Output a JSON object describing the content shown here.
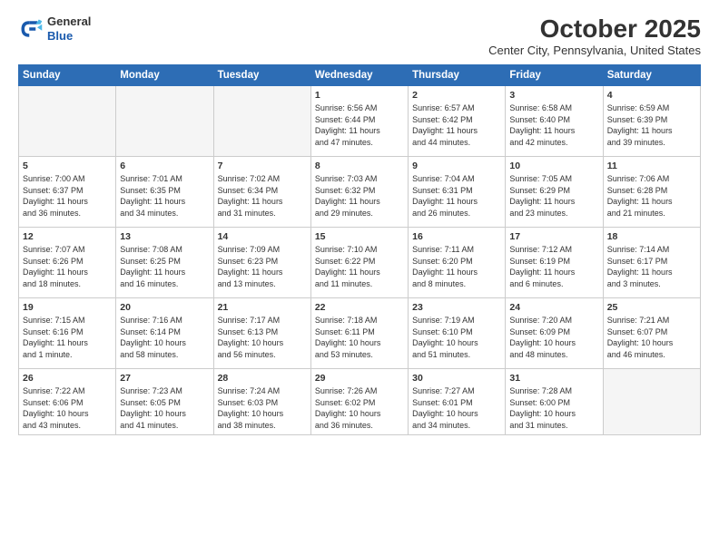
{
  "logo": {
    "general": "General",
    "blue": "Blue"
  },
  "header": {
    "month_title": "October 2025",
    "location": "Center City, Pennsylvania, United States"
  },
  "weekdays": [
    "Sunday",
    "Monday",
    "Tuesday",
    "Wednesday",
    "Thursday",
    "Friday",
    "Saturday"
  ],
  "weeks": [
    [
      {
        "day": "",
        "info": ""
      },
      {
        "day": "",
        "info": ""
      },
      {
        "day": "",
        "info": ""
      },
      {
        "day": "1",
        "info": "Sunrise: 6:56 AM\nSunset: 6:44 PM\nDaylight: 11 hours\nand 47 minutes."
      },
      {
        "day": "2",
        "info": "Sunrise: 6:57 AM\nSunset: 6:42 PM\nDaylight: 11 hours\nand 44 minutes."
      },
      {
        "day": "3",
        "info": "Sunrise: 6:58 AM\nSunset: 6:40 PM\nDaylight: 11 hours\nand 42 minutes."
      },
      {
        "day": "4",
        "info": "Sunrise: 6:59 AM\nSunset: 6:39 PM\nDaylight: 11 hours\nand 39 minutes."
      }
    ],
    [
      {
        "day": "5",
        "info": "Sunrise: 7:00 AM\nSunset: 6:37 PM\nDaylight: 11 hours\nand 36 minutes."
      },
      {
        "day": "6",
        "info": "Sunrise: 7:01 AM\nSunset: 6:35 PM\nDaylight: 11 hours\nand 34 minutes."
      },
      {
        "day": "7",
        "info": "Sunrise: 7:02 AM\nSunset: 6:34 PM\nDaylight: 11 hours\nand 31 minutes."
      },
      {
        "day": "8",
        "info": "Sunrise: 7:03 AM\nSunset: 6:32 PM\nDaylight: 11 hours\nand 29 minutes."
      },
      {
        "day": "9",
        "info": "Sunrise: 7:04 AM\nSunset: 6:31 PM\nDaylight: 11 hours\nand 26 minutes."
      },
      {
        "day": "10",
        "info": "Sunrise: 7:05 AM\nSunset: 6:29 PM\nDaylight: 11 hours\nand 23 minutes."
      },
      {
        "day": "11",
        "info": "Sunrise: 7:06 AM\nSunset: 6:28 PM\nDaylight: 11 hours\nand 21 minutes."
      }
    ],
    [
      {
        "day": "12",
        "info": "Sunrise: 7:07 AM\nSunset: 6:26 PM\nDaylight: 11 hours\nand 18 minutes."
      },
      {
        "day": "13",
        "info": "Sunrise: 7:08 AM\nSunset: 6:25 PM\nDaylight: 11 hours\nand 16 minutes."
      },
      {
        "day": "14",
        "info": "Sunrise: 7:09 AM\nSunset: 6:23 PM\nDaylight: 11 hours\nand 13 minutes."
      },
      {
        "day": "15",
        "info": "Sunrise: 7:10 AM\nSunset: 6:22 PM\nDaylight: 11 hours\nand 11 minutes."
      },
      {
        "day": "16",
        "info": "Sunrise: 7:11 AM\nSunset: 6:20 PM\nDaylight: 11 hours\nand 8 minutes."
      },
      {
        "day": "17",
        "info": "Sunrise: 7:12 AM\nSunset: 6:19 PM\nDaylight: 11 hours\nand 6 minutes."
      },
      {
        "day": "18",
        "info": "Sunrise: 7:14 AM\nSunset: 6:17 PM\nDaylight: 11 hours\nand 3 minutes."
      }
    ],
    [
      {
        "day": "19",
        "info": "Sunrise: 7:15 AM\nSunset: 6:16 PM\nDaylight: 11 hours\nand 1 minute."
      },
      {
        "day": "20",
        "info": "Sunrise: 7:16 AM\nSunset: 6:14 PM\nDaylight: 10 hours\nand 58 minutes."
      },
      {
        "day": "21",
        "info": "Sunrise: 7:17 AM\nSunset: 6:13 PM\nDaylight: 10 hours\nand 56 minutes."
      },
      {
        "day": "22",
        "info": "Sunrise: 7:18 AM\nSunset: 6:11 PM\nDaylight: 10 hours\nand 53 minutes."
      },
      {
        "day": "23",
        "info": "Sunrise: 7:19 AM\nSunset: 6:10 PM\nDaylight: 10 hours\nand 51 minutes."
      },
      {
        "day": "24",
        "info": "Sunrise: 7:20 AM\nSunset: 6:09 PM\nDaylight: 10 hours\nand 48 minutes."
      },
      {
        "day": "25",
        "info": "Sunrise: 7:21 AM\nSunset: 6:07 PM\nDaylight: 10 hours\nand 46 minutes."
      }
    ],
    [
      {
        "day": "26",
        "info": "Sunrise: 7:22 AM\nSunset: 6:06 PM\nDaylight: 10 hours\nand 43 minutes."
      },
      {
        "day": "27",
        "info": "Sunrise: 7:23 AM\nSunset: 6:05 PM\nDaylight: 10 hours\nand 41 minutes."
      },
      {
        "day": "28",
        "info": "Sunrise: 7:24 AM\nSunset: 6:03 PM\nDaylight: 10 hours\nand 38 minutes."
      },
      {
        "day": "29",
        "info": "Sunrise: 7:26 AM\nSunset: 6:02 PM\nDaylight: 10 hours\nand 36 minutes."
      },
      {
        "day": "30",
        "info": "Sunrise: 7:27 AM\nSunset: 6:01 PM\nDaylight: 10 hours\nand 34 minutes."
      },
      {
        "day": "31",
        "info": "Sunrise: 7:28 AM\nSunset: 6:00 PM\nDaylight: 10 hours\nand 31 minutes."
      },
      {
        "day": "",
        "info": ""
      }
    ]
  ]
}
